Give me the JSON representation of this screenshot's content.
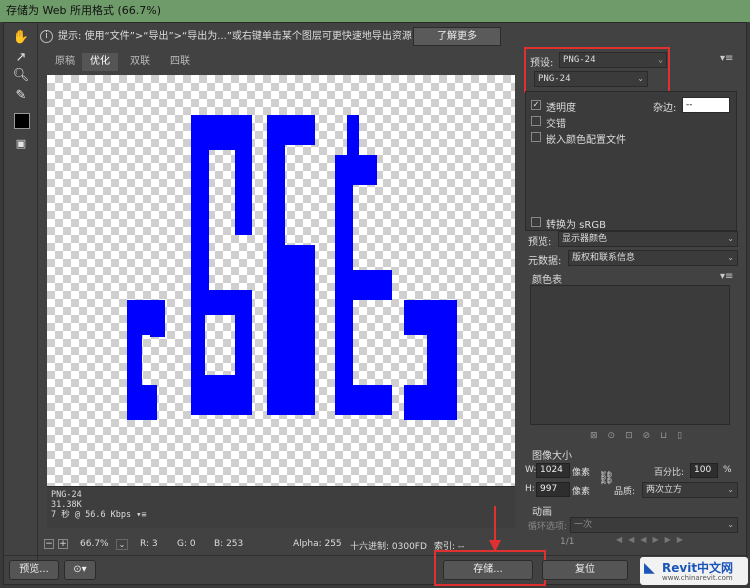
{
  "window": {
    "title": "存储为 Web 所用格式 (66.7%)"
  },
  "tip": {
    "text": "提示: 使用“文件”>“导出”>“导出为...”或右键单击某个图层可更快速地导出资源",
    "learn_more": "了解更多"
  },
  "tabs": [
    {
      "label": "原稿",
      "active": false
    },
    {
      "label": "优化",
      "active": true
    },
    {
      "label": "双联",
      "active": false
    },
    {
      "label": "四联",
      "active": false
    }
  ],
  "image": {
    "letters": "cSGEc",
    "color": "#0000ff"
  },
  "info": {
    "format": "PNG-24",
    "size": "31.38K",
    "time": "7 秒 @ 56.6 Kbps"
  },
  "status": {
    "zoom": "66.7%",
    "r": "R: 3",
    "g": "G: 0",
    "b": "B: 253",
    "alpha": "Alpha: 255",
    "hex": "十六进制: 0300FD",
    "index": "索引: --"
  },
  "settings": {
    "preset_label": "预设:",
    "preset_value": "PNG-24",
    "format_value": "PNG-24",
    "transparency": "透明度",
    "matte_label": "杂边:",
    "matte_value": "--",
    "interlaced": "交错",
    "embed_profile": "嵌入颜色配置文件",
    "convert_srgb": "转换为 sRGB",
    "preview_label": "预览:",
    "preview_value": "显示器颜色",
    "metadata_label": "元数据:",
    "metadata_value": "版权和联系信息",
    "color_table": "颜色表"
  },
  "image_size": {
    "title": "图像大小",
    "w_label": "W:",
    "w_value": "1024",
    "h_label": "H:",
    "h_value": "997",
    "unit": "像素",
    "percent_label": "百分比:",
    "percent_value": "100",
    "percent_unit": "%",
    "quality_label": "品质:",
    "quality_value": "两次立方"
  },
  "animation": {
    "title": "动画",
    "loop_label": "循环选项:",
    "loop_value": "一次",
    "frame": "1/1"
  },
  "buttons": {
    "preview": "预览...",
    "save": "存储...",
    "reset": "复位"
  },
  "watermark": {
    "text": "Revit中文网",
    "url": "www.chinarevit.com"
  },
  "colors": {
    "accent": "#e03030",
    "blue": "#0000ff"
  }
}
